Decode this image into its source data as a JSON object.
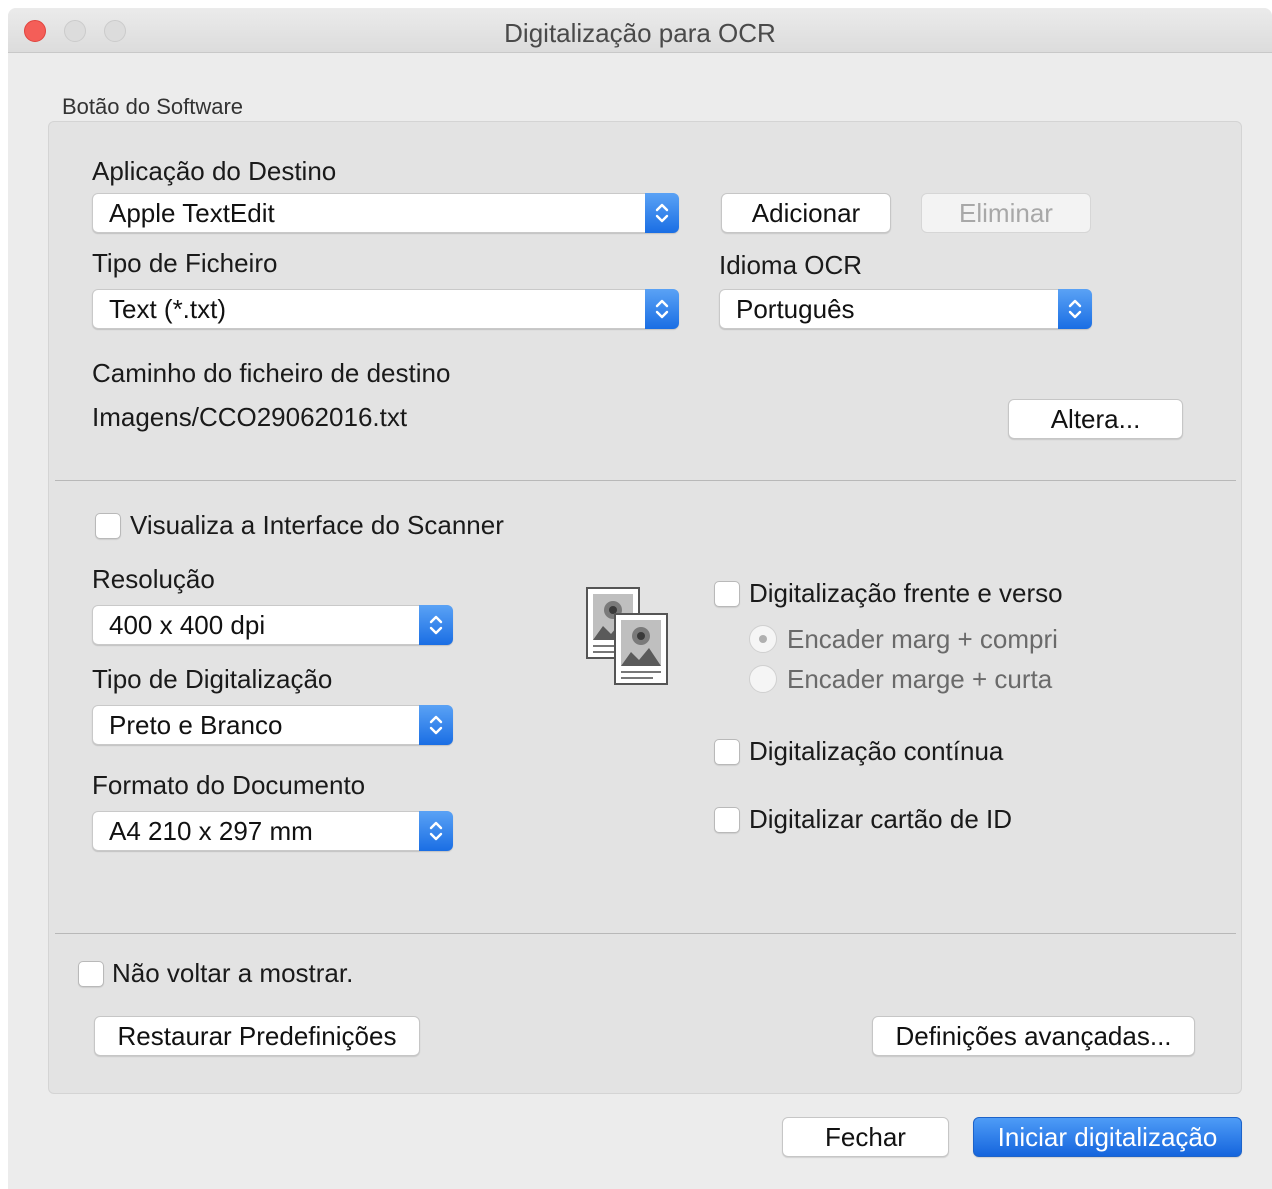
{
  "window": {
    "title": "Digitalização para OCR"
  },
  "group": {
    "label": "Botão do Software"
  },
  "destination_app": {
    "label": "Aplicação do Destino",
    "value": "Apple TextEdit",
    "add_label": "Adicionar",
    "delete_label": "Eliminar"
  },
  "file_type": {
    "label": "Tipo de Ficheiro",
    "value": "Text (*.txt)"
  },
  "ocr_language": {
    "label": "Idioma OCR",
    "value": "Português"
  },
  "destination_path": {
    "label": "Caminho do ficheiro de destino",
    "value": "Imagens/CCO29062016.txt",
    "change_label": "Altera..."
  },
  "scanner_interface": {
    "label": "Visualiza a Interface do Scanner",
    "checked": false
  },
  "resolution": {
    "label": "Resolução",
    "value": "400 x 400 dpi"
  },
  "scan_type": {
    "label": "Tipo de Digitalização",
    "value": "Preto e Branco"
  },
  "document_size": {
    "label": "Formato do Documento",
    "value": "A4 210 x 297 mm"
  },
  "duplex": {
    "label": "Digitalização frente e verso",
    "checked": false,
    "options": [
      {
        "label": "Encader marg + compri",
        "selected": true
      },
      {
        "label": "Encader marge + curta",
        "selected": false
      }
    ]
  },
  "continuous_scan": {
    "label": "Digitalização contínua",
    "checked": false
  },
  "id_card_scan": {
    "label": "Digitalizar cartão de ID",
    "checked": false
  },
  "dont_show_again": {
    "label": "Não voltar a mostrar.",
    "checked": false
  },
  "restore_defaults_label": "Restaurar Predefinições",
  "advanced_settings_label": "Definições avançadas...",
  "close_label": "Fechar",
  "start_scan_label": "Iniciar digitalização",
  "colors": {
    "accent": "#1a6ee4",
    "close_dot": "#f45e58"
  }
}
